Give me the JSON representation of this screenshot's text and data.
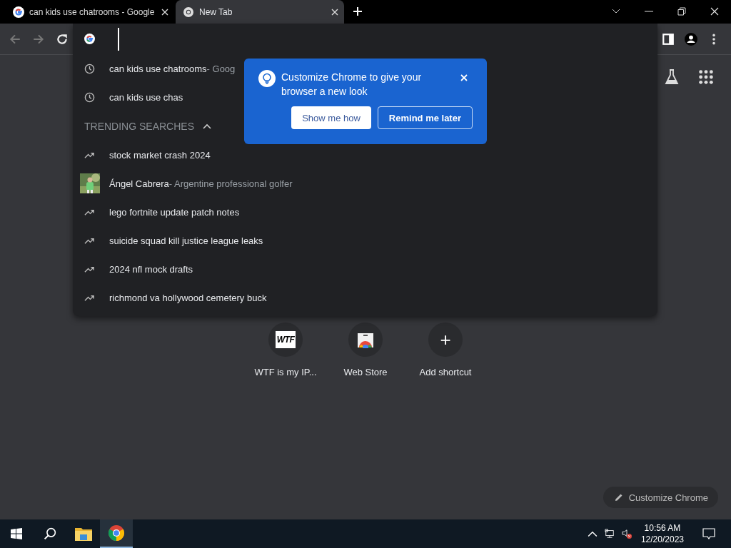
{
  "tabs": [
    {
      "title": "can kids use chatrooms - Google",
      "kind": "google",
      "selected": false
    },
    {
      "title": "New Tab",
      "kind": "chrome",
      "selected": true
    }
  ],
  "omnibox": {
    "focused": true
  },
  "suggestions": [
    {
      "kind": "history",
      "text": "can kids use chatrooms",
      "description": "- Goog"
    },
    {
      "kind": "history",
      "text": "can kids use chas"
    }
  ],
  "trending": {
    "title": "TRENDING SEARCHES",
    "expanded": true,
    "items": [
      {
        "kind": "trend",
        "text": "stock market crash 2024"
      },
      {
        "kind": "entity",
        "text": "Ángel Cabrera",
        "description": "- Argentine professional golfer"
      },
      {
        "kind": "trend",
        "text": "lego fortnite update patch notes"
      },
      {
        "kind": "trend",
        "text": "suicide squad kill justice league leaks"
      },
      {
        "kind": "trend",
        "text": "2024 nfl mock drafts"
      },
      {
        "kind": "trend",
        "text": "richmond va hollywood cemetery buck"
      }
    ]
  },
  "promo": {
    "text": "Customize Chrome to give your browser a new look",
    "buttons": [
      {
        "label": "Show me how",
        "kind": "primary"
      },
      {
        "label": "Remind me later",
        "kind": "outline"
      }
    ]
  },
  "shortcuts": [
    {
      "label": "WTF is my IP...",
      "kind": "wtf",
      "badge": "WTF"
    },
    {
      "label": "Web Store",
      "kind": "store"
    },
    {
      "label": "Add shortcut",
      "kind": "add",
      "glyph": "+"
    }
  ],
  "customize_button": "Customize Chrome",
  "taskbar": {
    "apps": [
      {
        "kind": "explorer",
        "selected": false
      },
      {
        "kind": "chrome",
        "selected": true
      }
    ],
    "time": "10:56 AM",
    "date": "12/20/2023"
  }
}
